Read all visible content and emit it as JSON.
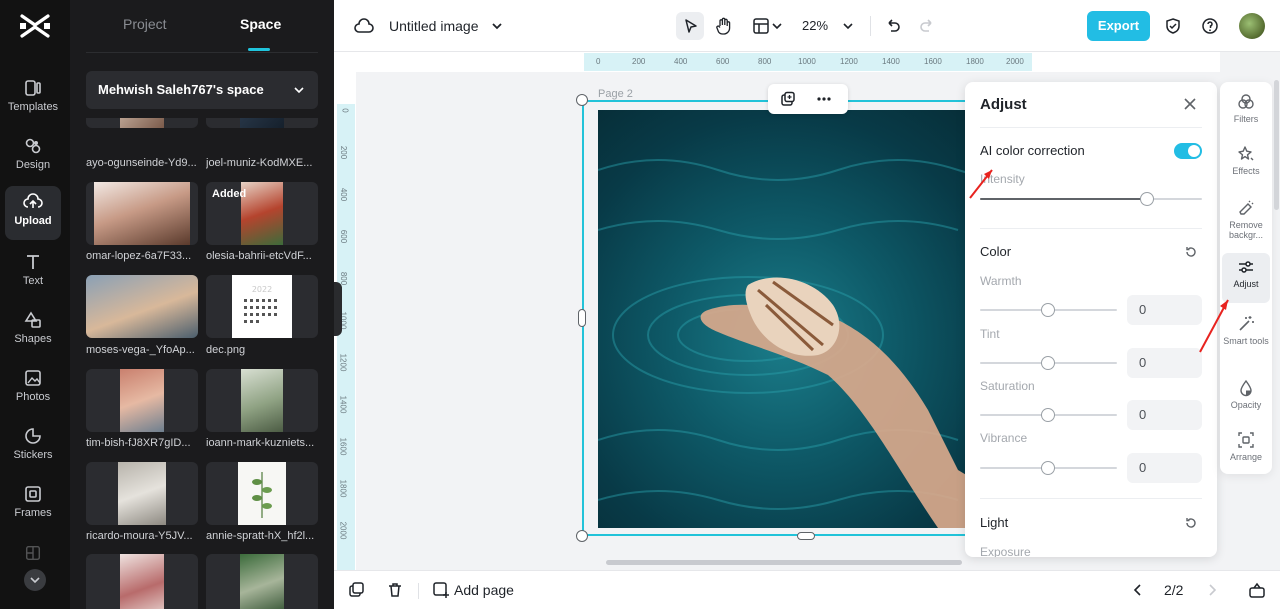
{
  "rail": {
    "items": [
      {
        "label": "Templates"
      },
      {
        "label": "Design"
      },
      {
        "label": "Upload"
      },
      {
        "label": "Text"
      },
      {
        "label": "Shapes"
      },
      {
        "label": "Photos"
      },
      {
        "label": "Stickers"
      },
      {
        "label": "Frames"
      }
    ]
  },
  "panel": {
    "tabs": [
      "Project",
      "Space"
    ],
    "active_tab": "Space",
    "space_name": "Mehwish Saleh767's space",
    "added_badge": "Added",
    "files": [
      "ayo-ogunseinde-Yd9...",
      "joel-muniz-KodMXE...",
      "omar-lopez-6a7F33...",
      "olesia-bahrii-etcVdF...",
      "moses-vega-_YfoAp...",
      "dec.png",
      "tim-bish-fJ8XR7gID...",
      "ioann-mark-kuzniets...",
      "ricardo-moura-Y5JV...",
      "annie-spratt-hX_hf2l..."
    ]
  },
  "topbar": {
    "title": "Untitled image",
    "zoom": "22%",
    "export_label": "Export"
  },
  "canvas": {
    "page_label": "Page 2",
    "ruler_top": [
      "0",
      "200",
      "400",
      "600",
      "800",
      "1000",
      "1200",
      "1400",
      "1600",
      "1800",
      "2000"
    ],
    "ruler_left": [
      "0",
      "200",
      "400",
      "600",
      "800",
      "1000",
      "1200",
      "1400",
      "1600",
      "1800",
      "2000"
    ]
  },
  "adjust": {
    "title": "Adjust",
    "ai_label": "AI color correction",
    "intensity_label": "Intensity",
    "intensity_level": 0.75,
    "color_section": "Color",
    "sliders": [
      {
        "label": "Warmth",
        "value": "0"
      },
      {
        "label": "Tint",
        "value": "0"
      },
      {
        "label": "Saturation",
        "value": "0"
      },
      {
        "label": "Vibrance",
        "value": "0"
      }
    ],
    "light_section": "Light",
    "exposure_label": "Exposure"
  },
  "tools": [
    {
      "label": "Filters"
    },
    {
      "label": "Effects"
    },
    {
      "label": "Remove backgr..."
    },
    {
      "label": "Adjust"
    },
    {
      "label": "Smart tools"
    },
    {
      "label": "Opacity"
    },
    {
      "label": "Arrange"
    }
  ],
  "bottombar": {
    "add_page": "Add page",
    "pager": "2/2"
  },
  "colors": {
    "accent": "#22bde4",
    "rail_bg": "#121212",
    "panel_bg": "#1b1b1d",
    "arrow": "#e8231f"
  }
}
